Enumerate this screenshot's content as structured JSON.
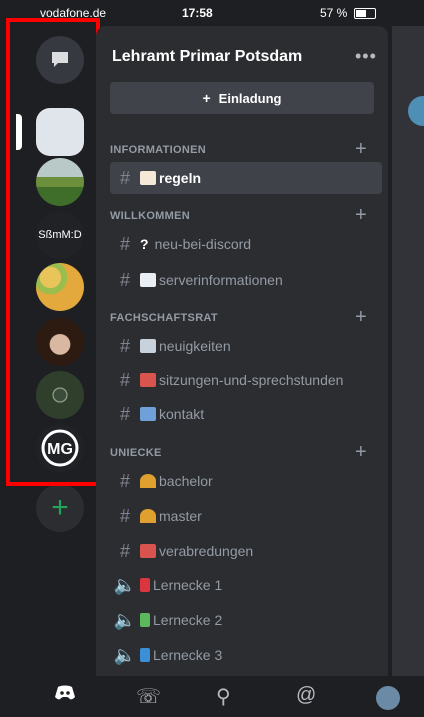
{
  "status_bar": {
    "carrier": "vodafone.de",
    "time": "17:58",
    "battery": "57 %"
  },
  "server": {
    "name": "Lehramt Primar Potsdam",
    "more_label": "•••",
    "invite_label": "Einladung"
  },
  "rail": {
    "servers": [
      {
        "name": "direct-messages",
        "label": ""
      },
      {
        "name": "server-1",
        "label": ""
      },
      {
        "name": "server-2",
        "label": ""
      },
      {
        "name": "server-3",
        "label": "SßmM:D"
      },
      {
        "name": "server-4",
        "label": ""
      },
      {
        "name": "server-5",
        "label": ""
      },
      {
        "name": "server-6",
        "label": ""
      },
      {
        "name": "server-7",
        "label": ""
      }
    ],
    "add_label": "+"
  },
  "categories": [
    {
      "name": "INFORMATIONEN",
      "plus": "+"
    },
    {
      "name": "WILLKOMMEN",
      "plus": "+"
    },
    {
      "name": "FACHSCHAFTSRAT",
      "plus": "+"
    },
    {
      "name": "UNIECKE",
      "plus": "+"
    }
  ],
  "channels": [
    {
      "label": "regeln",
      "icon": "#",
      "emoji_color": "#f4e9d8"
    },
    {
      "label": "neu-bei-discord",
      "icon": "#",
      "emoji_text": "?"
    },
    {
      "label": "serverinformationen",
      "icon": "#",
      "emoji_color": "#e9eef4"
    },
    {
      "label": "neuigkeiten",
      "icon": "#",
      "emoji_color": "#c7d2dc"
    },
    {
      "label": "sitzungen-und-sprechstunden",
      "icon": "#",
      "emoji_color": "#d9534f"
    },
    {
      "label": "kontakt",
      "icon": "#",
      "emoji_color": "#6fa0d8"
    },
    {
      "label": "bachelor",
      "icon": "#",
      "emoji_color": "#e0a030"
    },
    {
      "label": "master",
      "icon": "#",
      "emoji_color": "#e0a030"
    },
    {
      "label": "verabredungen",
      "icon": "#",
      "emoji_color": "#d9534f"
    },
    {
      "label": "Lernecke 1",
      "icon": "speaker",
      "emoji_color": "#d9363e"
    },
    {
      "label": "Lernecke 2",
      "icon": "speaker",
      "emoji_color": "#5cb85c"
    },
    {
      "label": "Lernecke 3",
      "icon": "speaker",
      "emoji_color": "#3b8fd6"
    }
  ],
  "nav": [
    "discord-home-icon",
    "friends-icon",
    "search-icon",
    "mentions-icon",
    "profile-avatar"
  ]
}
